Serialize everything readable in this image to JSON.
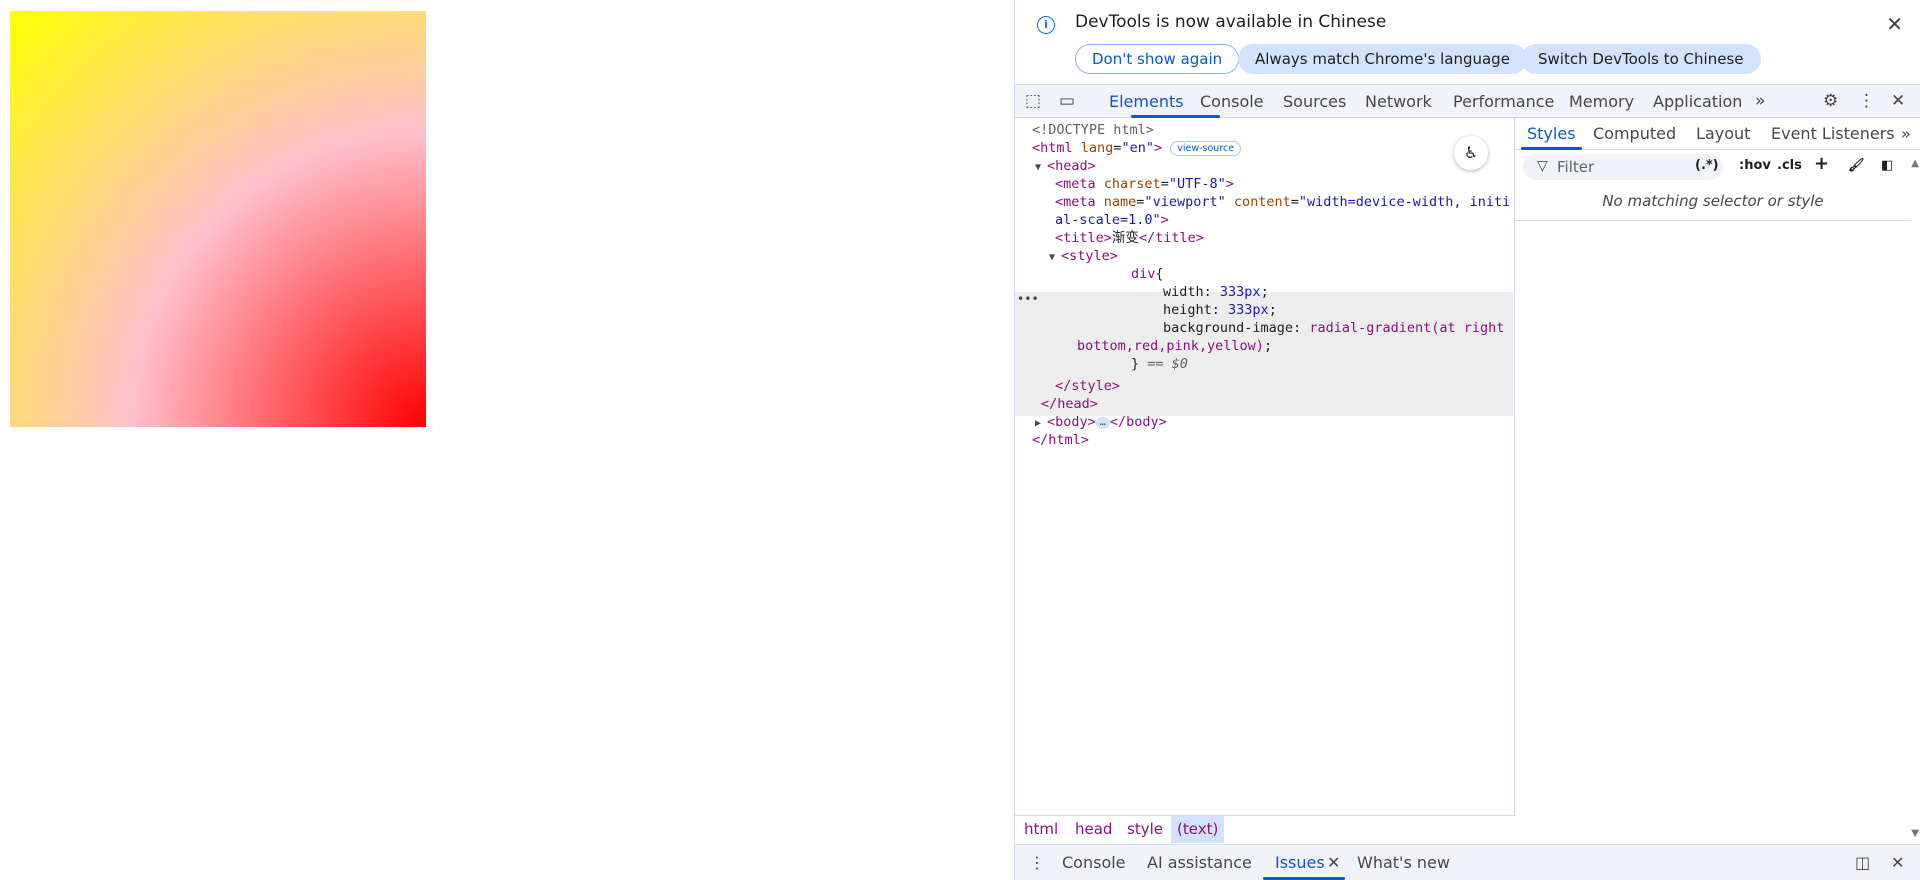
{
  "infobar": {
    "message": "DevTools is now available in Chinese",
    "buttons": [
      "Don't show again",
      "Always match Chrome's language",
      "Switch DevTools to Chinese"
    ]
  },
  "tabs": [
    "Elements",
    "Console",
    "Sources",
    "Network",
    "Performance",
    "Memory",
    "Application"
  ],
  "dom": {
    "doctype": "<!DOCTYPE html>",
    "html_open": "<html",
    "lang_attr": "lang",
    "lang_val": "\"en\"",
    "view_source": "view-source",
    "head": "<head>",
    "meta1_tag": "<meta",
    "meta1_attr": "charset",
    "meta1_val": "\"UTF-8\"",
    "meta2_name_attr": "name",
    "meta2_name_val": "\"viewport\"",
    "meta2_content_attr": "content",
    "meta2_content_val": "\"width=device-width, initi",
    "meta2_content_val2": "al-scale=1.0\"",
    "title_open": "<title>",
    "title_text": "渐变",
    "title_close": "</title>",
    "style_open": "<style>",
    "css_selector": "div",
    "css_width_prop": "width:",
    "css_width_val": "333px",
    "css_height_prop": "height:",
    "css_height_val": "333px",
    "css_bg_prop": "background-image:",
    "css_bg_val1": "radial-gradient(at right",
    "css_bg_val2": "bottom,red,pink,yellow)",
    "selected_marker": "== $0",
    "style_close": "</style>",
    "head_close": "</head>",
    "body_open": "<body>",
    "body_close": "</body>",
    "html_close": "</html>"
  },
  "breadcrumbs": [
    "html",
    "head",
    "style",
    "(text)"
  ],
  "styles_tabs": [
    "Styles",
    "Computed",
    "Layout",
    "Event Listeners"
  ],
  "filter_placeholder": "Filter",
  "filter_tools": [
    ":hov",
    ".cls"
  ],
  "no_match": "No matching selector or style",
  "drawer_tabs": [
    "Console",
    "AI assistance",
    "Issues",
    "What's new"
  ],
  "colors": {
    "accent": "#0b57d0",
    "tag": "#881280",
    "attr": "#994500",
    "attr_value": "#1a1aa6"
  }
}
